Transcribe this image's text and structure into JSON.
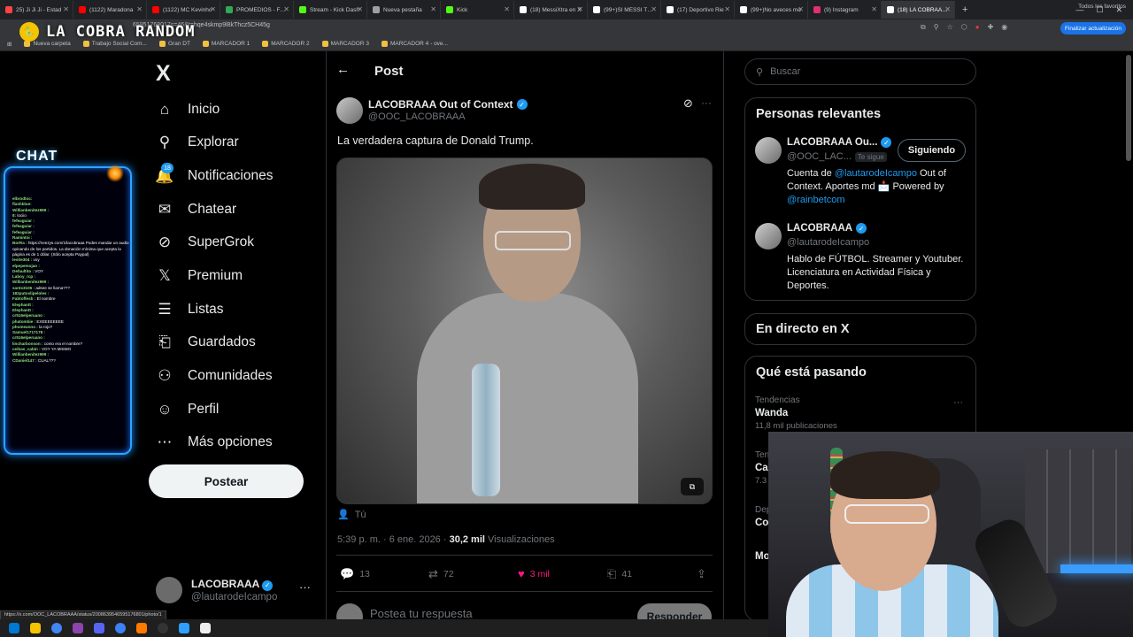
{
  "browser": {
    "tabs": [
      {
        "label": "25) Ji Ji Ji - Estad",
        "color": "#ff4444"
      },
      {
        "label": "(1122) Maradona",
        "color": "#ff0000"
      },
      {
        "label": "(1122) MC Kevinho",
        "color": "#ff0000"
      },
      {
        "label": "PROMEDIOS - Fútb",
        "color": "#34a853"
      },
      {
        "label": "Stream - Kick Dash",
        "color": "#53fc18"
      },
      {
        "label": "Nueva pestaña",
        "color": "#9aa0a6"
      },
      {
        "label": "Kick",
        "color": "#53fc18"
      },
      {
        "label": "(18) MessiXtra en X",
        "color": "#ffffff"
      },
      {
        "label": "(99+)SI MESSI TE P",
        "color": "#ffffff"
      },
      {
        "label": "(17) Deportivo Rie",
        "color": "#ffffff"
      },
      {
        "label": "(99+)No aveces mo",
        "color": "#ffffff"
      },
      {
        "label": "(9) Instagram",
        "color": "#e1306c"
      },
      {
        "label": "(18) LA COBRAAA O",
        "color": "#ffffff",
        "active": true
      }
    ],
    "url": "65951768017s=46&t=hqe4skmp9l8kThcz5CH45g",
    "update_label": "Finalizar actualización",
    "bookmarks": [
      "Nueva carpeta",
      "Trabajo Social Com...",
      "Gran DT",
      "MARCADOR 1",
      "MARCADOR 2",
      "MARCADOR 3",
      "MARCADOR 4 - ove..."
    ],
    "all_bookmarks": "Todos los favoritos"
  },
  "overlay": {
    "title": "LA COBRA RANDOM",
    "chat_label": "CHAT",
    "chat_lines": [
      {
        "user": "elbrodtoc:",
        "msg": ""
      },
      {
        "user": "flashblue:",
        "msg": ""
      },
      {
        "user": "Willianbenitez999 :",
        "msg": ""
      },
      {
        "user": "8:",
        "msg": "lociio"
      },
      {
        "user": "fefeaguiar :",
        "msg": ""
      },
      {
        "user": "fefeaguiar :",
        "msg": ""
      },
      {
        "user": "fefeaguiar :",
        "msg": ""
      },
      {
        "user": "Ramintoi :",
        "msg": ""
      },
      {
        "user": "BorRa :",
        "msg": "https://neezys.com/1/lacobraaa Podes mandar un audio opinando de los partidos. La donación mínima que acepta la página es de 1 dólar. (Sólo acepta Paypal)"
      },
      {
        "user": "lesite304 :",
        "msg": "voy"
      },
      {
        "user": "elpepemojao :",
        "msg": ""
      },
      {
        "user": "Defaultito :",
        "msg": "VOY"
      },
      {
        "user": "Laboy_rcp :",
        "msg": ""
      },
      {
        "user": "Willianbenitez999 :",
        "msg": ""
      },
      {
        "user": "santx3106 :",
        "msg": "adsee se llama???"
      },
      {
        "user": "182putoslipeloles :",
        "msg": ""
      },
      {
        "user": "Fabtoffesb :",
        "msg": "El nombre"
      },
      {
        "user": "Elephantt :",
        "msg": ""
      },
      {
        "user": "Elephantt :",
        "msg": ""
      },
      {
        "user": "cr516elperuano :",
        "msg": ""
      },
      {
        "user": "phatombie :",
        "msg": "EXEEEEEEEE"
      },
      {
        "user": "phomeanno :",
        "msg": "la rojo?"
      },
      {
        "user": "Samuel1717178 :",
        "msg": ""
      },
      {
        "user": "cr516elperuano :",
        "msg": ""
      },
      {
        "user": "lincharbonson :",
        "msg": "como era el nombre?"
      },
      {
        "user": "ceibas_cabin :",
        "msg": "VOY YA MISMO"
      },
      {
        "user": "Willianbenitez999 :",
        "msg": ""
      },
      {
        "user": "CDaniel147 :",
        "msg": "CUAL???"
      }
    ]
  },
  "sidebar": {
    "logo": "X",
    "items": [
      {
        "label": "Inicio",
        "icon": "home-icon",
        "glyph": "⌂"
      },
      {
        "label": "Explorar",
        "icon": "search-icon",
        "glyph": "⚲"
      },
      {
        "label": "Notificaciones",
        "icon": "bell-icon",
        "glyph": "🔔"
      },
      {
        "label": "Chatear",
        "icon": "mail-icon",
        "glyph": "✉"
      },
      {
        "label": "SuperGrok",
        "icon": "grok-icon",
        "glyph": "⊘"
      },
      {
        "label": "Premium",
        "icon": "x-icon",
        "glyph": "𝕏"
      },
      {
        "label": "Listas",
        "icon": "list-icon",
        "glyph": "☰"
      },
      {
        "label": "Guardados",
        "icon": "bookmark-icon",
        "glyph": "⎗"
      },
      {
        "label": "Comunidades",
        "icon": "people-icon",
        "glyph": "⚇"
      },
      {
        "label": "Perfil",
        "icon": "person-icon",
        "glyph": "☺"
      },
      {
        "label": "Más opciones",
        "icon": "more-circle-icon",
        "glyph": "⋯"
      }
    ],
    "notif_count": "18",
    "post_button": "Postear",
    "account": {
      "name": "LACOBRAAA",
      "handle": "@lautarodeIcampo",
      "more": "···"
    },
    "status_url": "https://x.com/OOC_LACOBRAAA/status/2008639546595176801/photo/1"
  },
  "main": {
    "title": "Post",
    "post": {
      "author": "LACOBRAAA Out of Context",
      "handle": "@OOC_LACOBRAAA",
      "text": "La verdadera captura de Donald Trump.",
      "tagged": "Tú",
      "time": "5:39 p. m. · 6 ene. 2026 · ",
      "views": "30,2 mil",
      "views_label": " Visualizaciones",
      "replies": "13",
      "reposts": "72",
      "likes": "3 mil",
      "bookmarks": "41",
      "reply_placeholder": "Postea tu respuesta",
      "reply_button": "Responder"
    }
  },
  "right": {
    "search_placeholder": "Buscar",
    "relevant_title": "Personas relevantes",
    "people": [
      {
        "name": "LACOBRAAA Ou...",
        "handle": "@OOC_LAC...",
        "follows_you": "Te sigue",
        "bio_pre": "Cuenta de ",
        "bio_link": "@lautarodeIcampo",
        "bio_mid": " Out of Context. Aportes md 📩 Powered by ",
        "bio_link2": "@rainbetcom",
        "button": "Siguiendo"
      },
      {
        "name": "LACOBRAAA",
        "handle": "@lautarodeIcampo",
        "bio": "Hablo de FÚTBOL. Streamer y Youtuber. Licenciatura en Actividad Física y Deportes."
      }
    ],
    "live_title": "En directo en X",
    "happening_title": "Qué está pasando",
    "trends": [
      {
        "context": "Tendencias",
        "name": "Wanda",
        "count": "11,8 mil publicaciones"
      },
      {
        "context": "Ten",
        "name": "Ca",
        "count": "7.3"
      },
      {
        "context": "Dep",
        "name": "Co",
        "count": ""
      }
    ],
    "show_more": "Mo"
  }
}
